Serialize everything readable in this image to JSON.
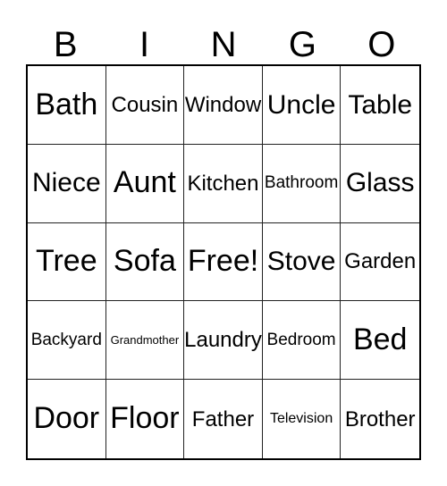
{
  "card": {
    "header_letters": [
      "B",
      "I",
      "N",
      "G",
      "O"
    ],
    "free_space_label": "Free!",
    "rows": [
      [
        {
          "label": "Bath",
          "size": "fs-xl"
        },
        {
          "label": "Cousin",
          "size": "fs-md"
        },
        {
          "label": "Window",
          "size": "fs-md"
        },
        {
          "label": "Uncle",
          "size": "fs-lg"
        },
        {
          "label": "Table",
          "size": "fs-lg"
        }
      ],
      [
        {
          "label": "Niece",
          "size": "fs-lg"
        },
        {
          "label": "Aunt",
          "size": "fs-xl"
        },
        {
          "label": "Kitchen",
          "size": "fs-md"
        },
        {
          "label": "Bathroom",
          "size": "fs-sm"
        },
        {
          "label": "Glass",
          "size": "fs-lg"
        }
      ],
      [
        {
          "label": "Tree",
          "size": "fs-xl"
        },
        {
          "label": "Sofa",
          "size": "fs-xl"
        },
        {
          "label": "Free!",
          "size": "fs-xl"
        },
        {
          "label": "Stove",
          "size": "fs-lg"
        },
        {
          "label": "Garden",
          "size": "fs-md"
        }
      ],
      [
        {
          "label": "Backyard",
          "size": "fs-sm"
        },
        {
          "label": "Grandmother",
          "size": "fs-xxs"
        },
        {
          "label": "Laundry",
          "size": "fs-md"
        },
        {
          "label": "Bedroom",
          "size": "fs-sm"
        },
        {
          "label": "Bed",
          "size": "fs-xl"
        }
      ],
      [
        {
          "label": "Door",
          "size": "fs-xl"
        },
        {
          "label": "Floor",
          "size": "fs-xl"
        },
        {
          "label": "Father",
          "size": "fs-md"
        },
        {
          "label": "Television",
          "size": "fs-xs"
        },
        {
          "label": "Brother",
          "size": "fs-md"
        }
      ]
    ]
  },
  "colors": {
    "background": "#ffffff",
    "text": "#000000",
    "grid_line": "#222222",
    "border": "#000000"
  }
}
